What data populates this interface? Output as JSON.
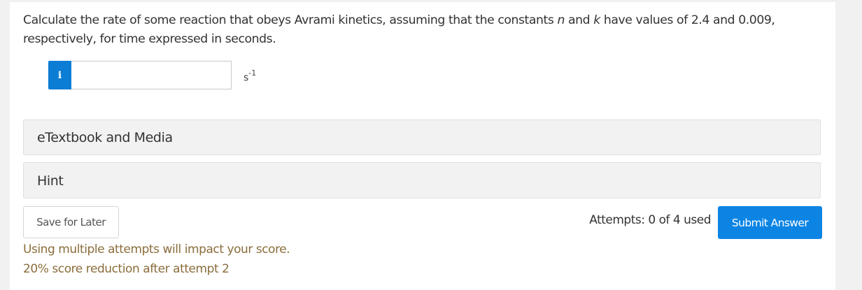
{
  "question": {
    "part1": "Calculate the rate of some reaction that obeys Avrami kinetics, assuming that the constants ",
    "var_n": "n",
    "part2": " and ",
    "var_k": "k",
    "part3": " have values of 2.4 and 0.009, respectively, for time expressed in seconds."
  },
  "answer": {
    "info_icon": "i",
    "info_icon_name": "info-icon",
    "input_value": "",
    "unit_base": "s",
    "unit_exponent": "-1"
  },
  "accordions": {
    "media_label": "eTextbook and Media",
    "hint_label": "Hint"
  },
  "footer": {
    "save_label": "Save for Later",
    "attempts_text": "Attempts: 0 of 4 used",
    "submit_label": "Submit Answer",
    "warning_line1": "Using multiple attempts will impact your score.",
    "warning_line2": "20% score reduction after attempt 2"
  },
  "colors": {
    "accent": "#0c84e4",
    "info_button": "#0c7dd4",
    "warning_text": "#8a6d3b",
    "panel_background": "#f2f2f2"
  }
}
